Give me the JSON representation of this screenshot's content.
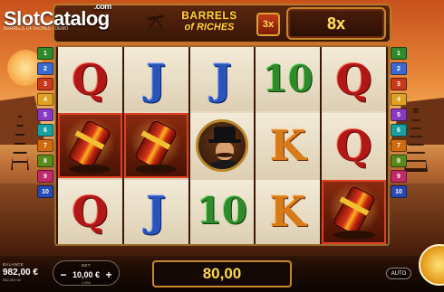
{
  "site_logo": {
    "part1": "Slot",
    "part2": "Catalog",
    "dotcom": ".com"
  },
  "game_caption": "BARRELS OF RICHES · DEMO",
  "game_title": {
    "line1": "BARRELS",
    "line2": "of RICHES"
  },
  "multiplier_badge": "3x",
  "multiplier_display": "8x",
  "paylines_left": [
    "1",
    "2",
    "3",
    "4",
    "5",
    "6",
    "7",
    "8",
    "9",
    "10"
  ],
  "paylines_right": [
    "1",
    "2",
    "3",
    "4",
    "5",
    "6",
    "7",
    "8",
    "9",
    "10"
  ],
  "payline_colors": [
    "#2e8a2a",
    "#3a6ad0",
    "#c83a1a",
    "#e0a020",
    "#8a3ac0",
    "#1aa0a0",
    "#d06a10",
    "#5a8a1a",
    "#c02a6a",
    "#2a4ab0"
  ],
  "reels": [
    [
      {
        "sym": "Q",
        "win": false
      },
      {
        "sym": "barrel",
        "win": true
      },
      {
        "sym": "Q",
        "win": false
      }
    ],
    [
      {
        "sym": "J",
        "win": false
      },
      {
        "sym": "barrel",
        "win": true
      },
      {
        "sym": "J",
        "win": false
      }
    ],
    [
      {
        "sym": "J",
        "win": false
      },
      {
        "sym": "tycoon",
        "win": false
      },
      {
        "sym": "10",
        "win": false
      }
    ],
    [
      {
        "sym": "10",
        "win": false
      },
      {
        "sym": "K",
        "win": false
      },
      {
        "sym": "K",
        "win": false
      }
    ],
    [
      {
        "sym": "Q",
        "win": false
      },
      {
        "sym": "Q",
        "win": false
      },
      {
        "sym": "barrel",
        "win": true
      }
    ]
  ],
  "balance": {
    "label": "BALANCE",
    "value": "982,00 €",
    "sub": "982,000.00"
  },
  "bet": {
    "label": "BET",
    "minus": "−",
    "plus": "+",
    "value": "10,00 €",
    "sub": "1.000"
  },
  "win_amount": "80,00",
  "auto_label": "AUTO"
}
